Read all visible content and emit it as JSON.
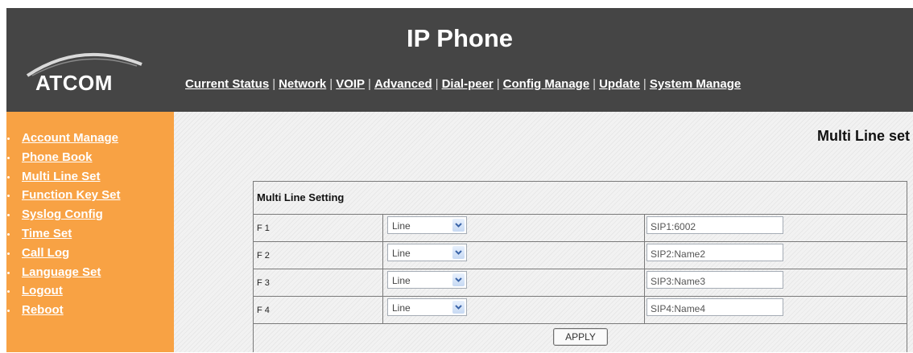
{
  "header": {
    "title": "IP Phone",
    "logo_text": "ATCOM",
    "nav": [
      {
        "label": "Current Status"
      },
      {
        "label": "Network"
      },
      {
        "label": "VOIP"
      },
      {
        "label": "Advanced"
      },
      {
        "label": "Dial-peer"
      },
      {
        "label": "Config Manage"
      },
      {
        "label": "Update"
      },
      {
        "label": "System Manage"
      }
    ]
  },
  "sidebar": {
    "items": [
      {
        "label": "Account Manage"
      },
      {
        "label": "Phone Book"
      },
      {
        "label": "Multi Line Set"
      },
      {
        "label": "Function Key Set"
      },
      {
        "label": "Syslog Config"
      },
      {
        "label": "Time Set"
      },
      {
        "label": "Call Log"
      },
      {
        "label": "Language Set"
      },
      {
        "label": "Logout"
      },
      {
        "label": "Reboot"
      }
    ]
  },
  "main": {
    "page_title": "Multi Line set",
    "section_title": "Multi Line Setting",
    "rows": [
      {
        "key": "F 1",
        "type": "Line",
        "value": "SIP1:6002"
      },
      {
        "key": "F 2",
        "type": "Line",
        "value": "SIP2:Name2"
      },
      {
        "key": "F 3",
        "type": "Line",
        "value": "SIP3:Name3"
      },
      {
        "key": "F 4",
        "type": "Line",
        "value": "SIP4:Name4"
      }
    ],
    "apply_label": "APPLY"
  },
  "colors": {
    "header_bg": "#454545",
    "sidebar_bg": "#f8a244",
    "content_bg": "#f2f2f2"
  }
}
